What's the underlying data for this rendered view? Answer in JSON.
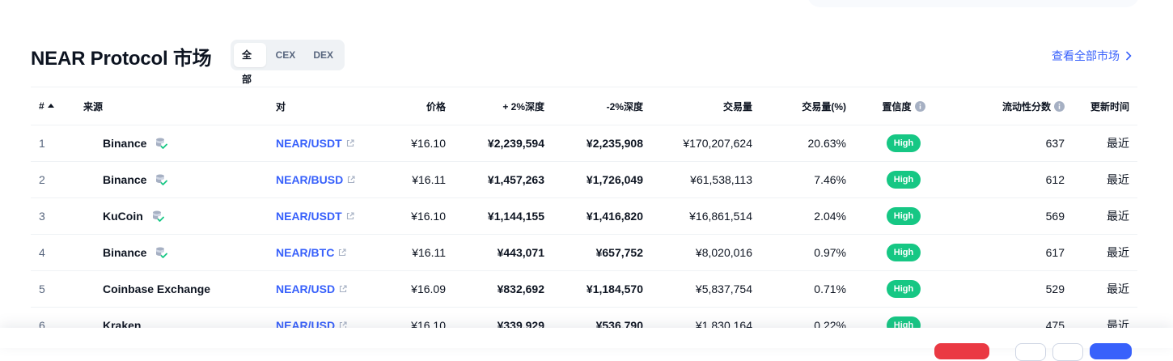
{
  "header": {
    "title": "NEAR Protocol 市场",
    "tabs": [
      {
        "label": "全部",
        "active": true
      },
      {
        "label": "CEX",
        "active": false
      },
      {
        "label": "DEX",
        "active": false
      }
    ],
    "view_all_label": "查看全部市场"
  },
  "table": {
    "columns": {
      "rank": "#",
      "source": "来源",
      "pair": "对",
      "price": "价格",
      "depth_plus": "+ 2%深度",
      "depth_minus": "-2%深度",
      "volume": "交易量",
      "volume_pct": "交易量(%)",
      "confidence": "置信度",
      "liquidity": "流动性分数",
      "updated": "更新时间"
    },
    "rows": [
      {
        "rank": "1",
        "source": "Binance",
        "verified": true,
        "pair": "NEAR/USDT",
        "price": "¥16.10",
        "depth_plus": "¥2,239,594",
        "depth_minus": "¥2,235,908",
        "volume": "¥170,207,624",
        "volume_pct": "20.63%",
        "confidence": "High",
        "liquidity": "637",
        "updated": "最近"
      },
      {
        "rank": "2",
        "source": "Binance",
        "verified": true,
        "pair": "NEAR/BUSD",
        "price": "¥16.11",
        "depth_plus": "¥1,457,263",
        "depth_minus": "¥1,726,049",
        "volume": "¥61,538,113",
        "volume_pct": "7.46%",
        "confidence": "High",
        "liquidity": "612",
        "updated": "最近"
      },
      {
        "rank": "3",
        "source": "KuCoin",
        "verified": true,
        "pair": "NEAR/USDT",
        "price": "¥16.10",
        "depth_plus": "¥1,144,155",
        "depth_minus": "¥1,416,820",
        "volume": "¥16,861,514",
        "volume_pct": "2.04%",
        "confidence": "High",
        "liquidity": "569",
        "updated": "最近"
      },
      {
        "rank": "4",
        "source": "Binance",
        "verified": true,
        "pair": "NEAR/BTC",
        "price": "¥16.11",
        "depth_plus": "¥443,071",
        "depth_minus": "¥657,752",
        "volume": "¥8,020,016",
        "volume_pct": "0.97%",
        "confidence": "High",
        "liquidity": "617",
        "updated": "最近"
      },
      {
        "rank": "5",
        "source": "Coinbase Exchange",
        "verified": false,
        "pair": "NEAR/USD",
        "price": "¥16.09",
        "depth_plus": "¥832,692",
        "depth_minus": "¥1,184,570",
        "volume": "¥5,837,754",
        "volume_pct": "0.71%",
        "confidence": "High",
        "liquidity": "529",
        "updated": "最近"
      },
      {
        "rank": "6",
        "source": "Kraken",
        "verified": false,
        "pair": "NEAR/USD",
        "price": "¥16.10",
        "depth_plus": "¥339,929",
        "depth_minus": "¥536,790",
        "volume": "¥1,830,164",
        "volume_pct": "0.22%",
        "confidence": "High",
        "liquidity": "475",
        "updated": "最近"
      }
    ]
  },
  "colors": {
    "accent": "#3861fb",
    "high_badge": "#16c784",
    "text": "#0d1421",
    "muted": "#58667e"
  }
}
